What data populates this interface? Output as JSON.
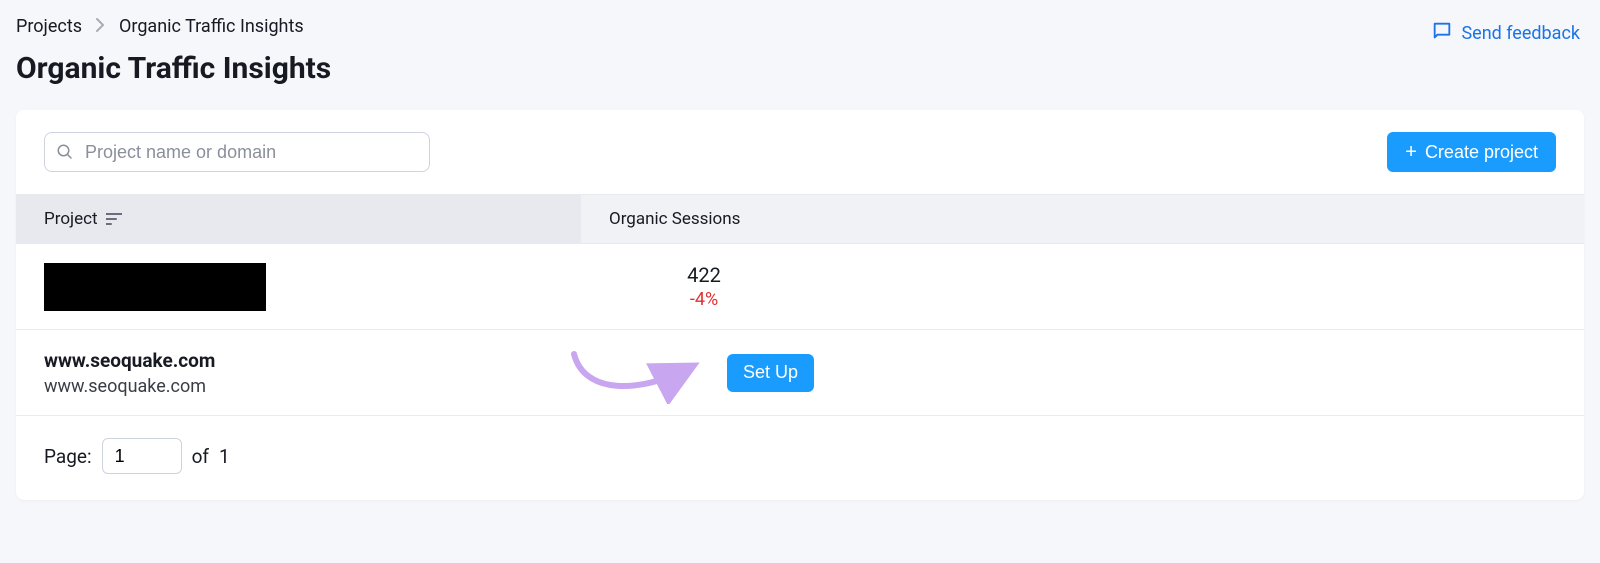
{
  "breadcrumb": {
    "root": "Projects",
    "current": "Organic Traffic Insights"
  },
  "page_title": "Organic Traffic Insights",
  "feedback_label": "Send feedback",
  "search": {
    "placeholder": "Project name or domain"
  },
  "create_button_label": "Create project",
  "table": {
    "col_project": "Project",
    "col_sessions": "Organic Sessions"
  },
  "rows": {
    "0": {
      "sessions_value": "422",
      "sessions_delta": "-4%"
    },
    "1": {
      "name": "www.seoquake.com",
      "domain": "www.seoquake.com",
      "setup_label": "Set Up"
    }
  },
  "pager": {
    "label": "Page:",
    "current": "1",
    "of_label": "of",
    "total": "1"
  },
  "colors": {
    "accent": "#1a9cff",
    "link": "#1a73e8",
    "negative": "#e03131",
    "annotation": "#c9a6f0"
  }
}
